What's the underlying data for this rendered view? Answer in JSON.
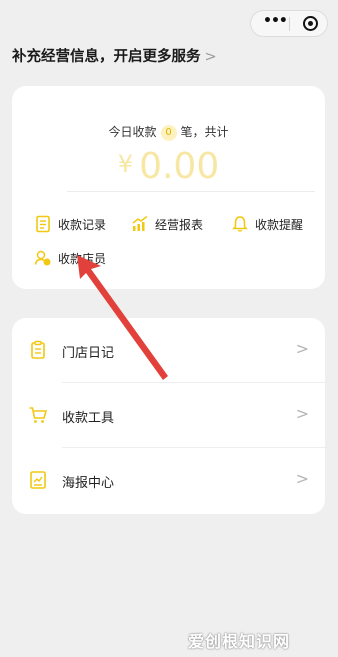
{
  "banner": {
    "text": "补充经营信息，开启更多服务",
    "chevron": ">"
  },
  "summary": {
    "prefix": "今日收款",
    "count": "0",
    "suffix": "笔，共计",
    "currency": "¥",
    "amount": "0.00"
  },
  "quick_actions": [
    {
      "label": "收款记录",
      "icon": "receipt-icon"
    },
    {
      "label": "经营报表",
      "icon": "chart-icon"
    },
    {
      "label": "收款提醒",
      "icon": "bell-icon"
    },
    {
      "label": "收款店员",
      "icon": "staff-icon"
    }
  ],
  "menu": [
    {
      "label": "门店日记",
      "icon": "clipboard-icon",
      "chevron": ">"
    },
    {
      "label": "收款工具",
      "icon": "cart-icon",
      "chevron": ">"
    },
    {
      "label": "海报中心",
      "icon": "poster-icon",
      "chevron": ">"
    }
  ],
  "colors": {
    "accent": "#f2c811",
    "arrow": "#e2413b"
  },
  "watermark": "爱创根知识网"
}
